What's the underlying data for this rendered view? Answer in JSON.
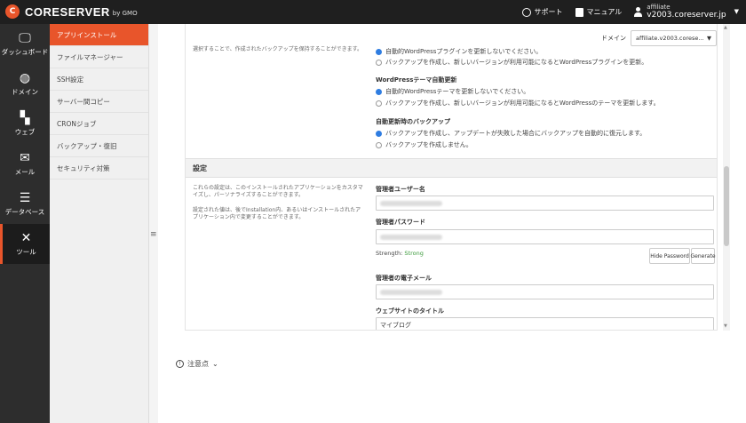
{
  "topbar": {
    "logo_text": "CORESERVER",
    "logo_sub": "by GMO",
    "support": "サポート",
    "manual": "マニュアル",
    "account_label": "affiliate",
    "account_server": "v2003.coreserver.jp"
  },
  "leftnav": [
    {
      "label": "ダッシュボード",
      "icon": "monitor-icon"
    },
    {
      "label": "ドメイン",
      "icon": "globe-icon"
    },
    {
      "label": "ウェブ",
      "icon": "grid-plus-icon"
    },
    {
      "label": "メール",
      "icon": "envelope-icon"
    },
    {
      "label": "データベース",
      "icon": "database-icon"
    },
    {
      "label": "ツール",
      "icon": "tools-icon"
    }
  ],
  "subnav": [
    "アプリインストール",
    "ファイルマネージャー",
    "SSH設定",
    "サーバー間コピー",
    "CRONジョブ",
    "バックアップ・復旧",
    "セキュリティ対策"
  ],
  "domain": {
    "label": "ドメイン",
    "value": "affiliate.v2003.corese..."
  },
  "top_desc": "選択することで、作成されたバックアップを保持することができます。",
  "plugins": {
    "opt1": "自動的WordPressプラグインを更新しないでください。",
    "opt2": "バックアップを作成し、新しいバージョンが利用可能になるとWordPressプラグインを更新。"
  },
  "theme": {
    "title": "WordPressテーマ自動更新",
    "opt1": "自動的WordPressテーマを更新しないでください。",
    "opt2": "バックアップを作成し、新しいバージョンが利用可能になるとWordPressのテーマを更新します。"
  },
  "backup": {
    "title": "自動更新時のバックアップ",
    "opt1": "バックアップを作成し、アップデートが失敗した場合にバックアップを自動的に復元します。",
    "opt2": "バックアップを作成しません。"
  },
  "settings": {
    "title": "設定",
    "desc1": "これらの設定は、このインストールされたアプリケーションをカスタマイズし、パーソナライズすることができます。",
    "desc2": "設定された値は、後でInstallation内、あるいはインストールされたアプリケーション内で変更することができます。",
    "admin_user_label": "管理者ユーザー名",
    "admin_pass_label": "管理者パスワード",
    "strength_label": "Strength:",
    "strength_value": "Strong",
    "hide_password": "Hide Password",
    "generate": "Generate",
    "admin_email_label": "管理者の電子メール",
    "site_title_label": "ウェブサイトのタイトル",
    "site_title_value": "マイブログ"
  },
  "note": "注意点",
  "colors": {
    "accent": "#e8552b",
    "radio_selected": "#2f7de1",
    "strength_strong": "#3c9b3c"
  }
}
